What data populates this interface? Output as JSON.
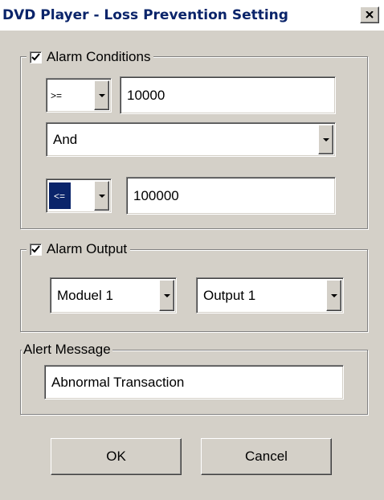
{
  "window": {
    "title": "DVD Player - Loss Prevention Setting",
    "close_glyph": "×"
  },
  "alarm_conditions": {
    "label": "Alarm Conditions",
    "checked": true,
    "condition1": {
      "operator": ">=",
      "value": "10000"
    },
    "logic": "And",
    "condition2": {
      "operator": "<=",
      "value": "100000"
    }
  },
  "alarm_output": {
    "label": "Alarm Output",
    "checked": true,
    "module": "Moduel 1",
    "output": "Output 1"
  },
  "alert_message": {
    "label": "Alert Message",
    "value": "Abnormal Transaction"
  },
  "buttons": {
    "ok": "OK",
    "cancel": "Cancel"
  },
  "icons": [
    "close-icon",
    "checkmark-icon",
    "chevron-down-icon"
  ],
  "colors": {
    "title_text": "#0a246a",
    "selection": "#0a246a",
    "face": "#d4d0c8"
  }
}
